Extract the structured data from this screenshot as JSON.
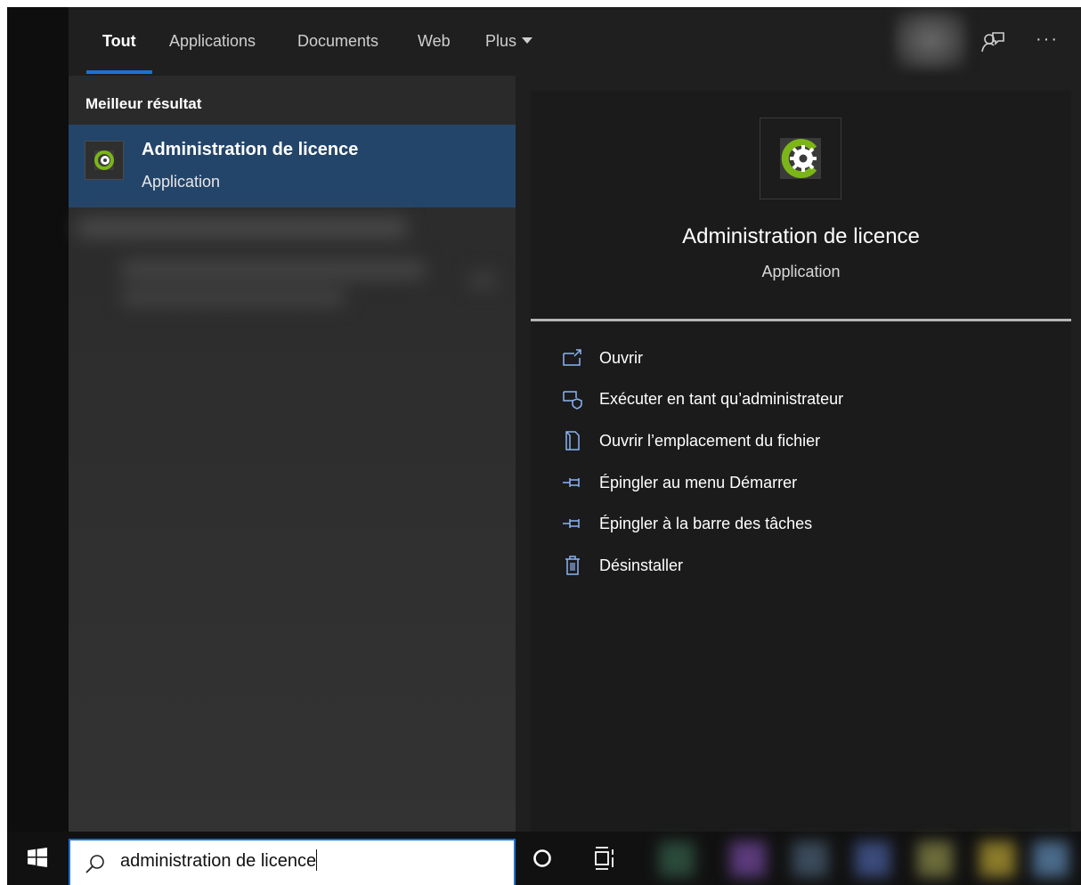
{
  "tabs": [
    {
      "label": "Tout",
      "active": true
    },
    {
      "label": "Applications",
      "active": false
    },
    {
      "label": "Documents",
      "active": false
    },
    {
      "label": "Web",
      "active": false
    },
    {
      "label": "Plus",
      "active": false
    }
  ],
  "header_icons": [
    "avatar",
    "feedback-icon",
    "more-options-icon"
  ],
  "more_label": "···",
  "best_match": {
    "section_title": "Meilleur résultat",
    "title": "Administration de licence",
    "subtitle": "Application"
  },
  "detail": {
    "title": "Administration de licence",
    "subtitle": "Application",
    "actions": [
      {
        "label": "Ouvrir",
        "icon": "open-icon"
      },
      {
        "label": "Exécuter en tant qu’administrateur",
        "icon": "run-as-admin-icon"
      },
      {
        "label": "Ouvrir l’emplacement du fichier",
        "icon": "file-location-icon"
      },
      {
        "label": "Épingler au menu Démarrer",
        "icon": "pin-icon"
      },
      {
        "label": "Épingler à la barre des tâches",
        "icon": "pin-icon"
      },
      {
        "label": "Désinstaller",
        "icon": "trash-icon"
      }
    ]
  },
  "search": {
    "value": "administration de licence"
  },
  "colors": {
    "accent": "#1a73d6",
    "selected_bg": "#24456a",
    "app_icon_green": "#7cb518"
  }
}
